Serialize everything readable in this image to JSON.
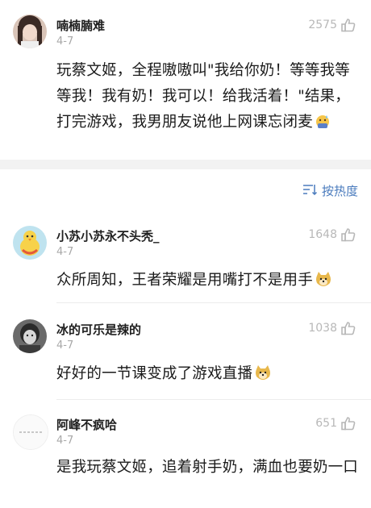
{
  "comments": [
    {
      "username": "喃楠腩难",
      "date": "4-7",
      "likes": "2575",
      "text": "玩蔡文姬，全程嗷嗷叫\"我给你奶！等等我等等我！我有奶！我可以！给我活着！\"结果，打完游戏，我男朋友说他上网课忘闭麦",
      "emoji": "sweat-emoji"
    },
    {
      "username": "小苏小苏永不头秃_",
      "date": "4-7",
      "likes": "1648",
      "text": "众所周知，王者荣耀是用嘴打不是用手",
      "emoji": "doge-emoji"
    },
    {
      "username": "冰的可乐是辣的",
      "date": "4-7",
      "likes": "1038",
      "text": "好好的一节课变成了游戏直播",
      "emoji": "doge-emoji"
    },
    {
      "username": "阿峰不疯哈",
      "date": "4-7",
      "likes": "651",
      "text": "是我玩蔡文姬，追着射手奶，满血也要奶一口",
      "emoji": ""
    }
  ],
  "sort": {
    "label": "按热度",
    "icon": "sort-icon"
  },
  "icons": {
    "like": "thumbs-up-icon"
  },
  "colors": {
    "accent": "#4a7bbd",
    "muted": "#a8a8a8",
    "band": "#f2f2f2"
  }
}
